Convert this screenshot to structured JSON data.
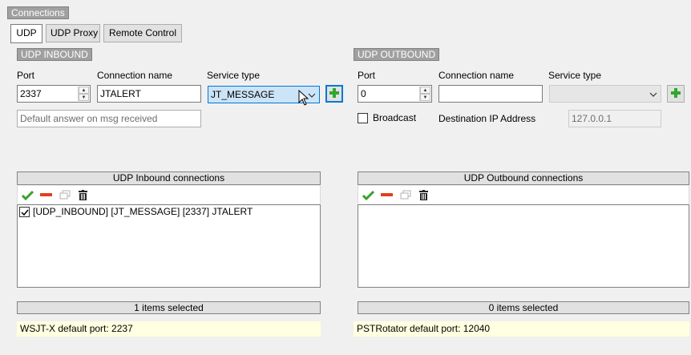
{
  "window": {
    "group_title": "Connections"
  },
  "tabs": [
    {
      "label": "UDP",
      "active": true
    },
    {
      "label": "UDP Proxy",
      "active": false
    },
    {
      "label": "Remote Control",
      "active": false
    }
  ],
  "inbound": {
    "section_title": "UDP INBOUND",
    "port_label": "Port",
    "port_value": "2337",
    "conn_name_label": "Connection name",
    "conn_name_value": "JTALERT",
    "service_type_label": "Service type",
    "service_type_value": "JT_MESSAGE",
    "default_answer_placeholder": "Default answer on msg received",
    "list_header": "UDP Inbound connections",
    "items": [
      {
        "checked": true,
        "label": "[UDP_INBOUND] [JT_MESSAGE] [2337] JTALERT"
      }
    ],
    "status": "1 items selected",
    "info": "WSJT-X default port: 2237"
  },
  "outbound": {
    "section_title": "UDP OUTBOUND",
    "port_label": "Port",
    "port_value": "0",
    "conn_name_label": "Connection name",
    "conn_name_value": "",
    "service_type_label": "Service type",
    "service_type_value": "",
    "broadcast_label": "Broadcast",
    "dest_ip_label": "Destination IP Address",
    "dest_ip_value": "127.0.0.1",
    "list_header": "UDP Outbound connections",
    "items": [],
    "status": "0 items selected",
    "info": "PSTRotator default port: 12040"
  },
  "icons": {
    "accept": "check-icon",
    "remove": "minus-icon",
    "copy": "copy-icon",
    "delete": "trash-icon",
    "add": "plus-icon"
  },
  "colors": {
    "accept_green": "#3aa02e",
    "remove_red": "#e04020",
    "add_green": "#2fa82f",
    "info_bg": "#ffffe1",
    "selection_blue": "#cce4f7"
  }
}
